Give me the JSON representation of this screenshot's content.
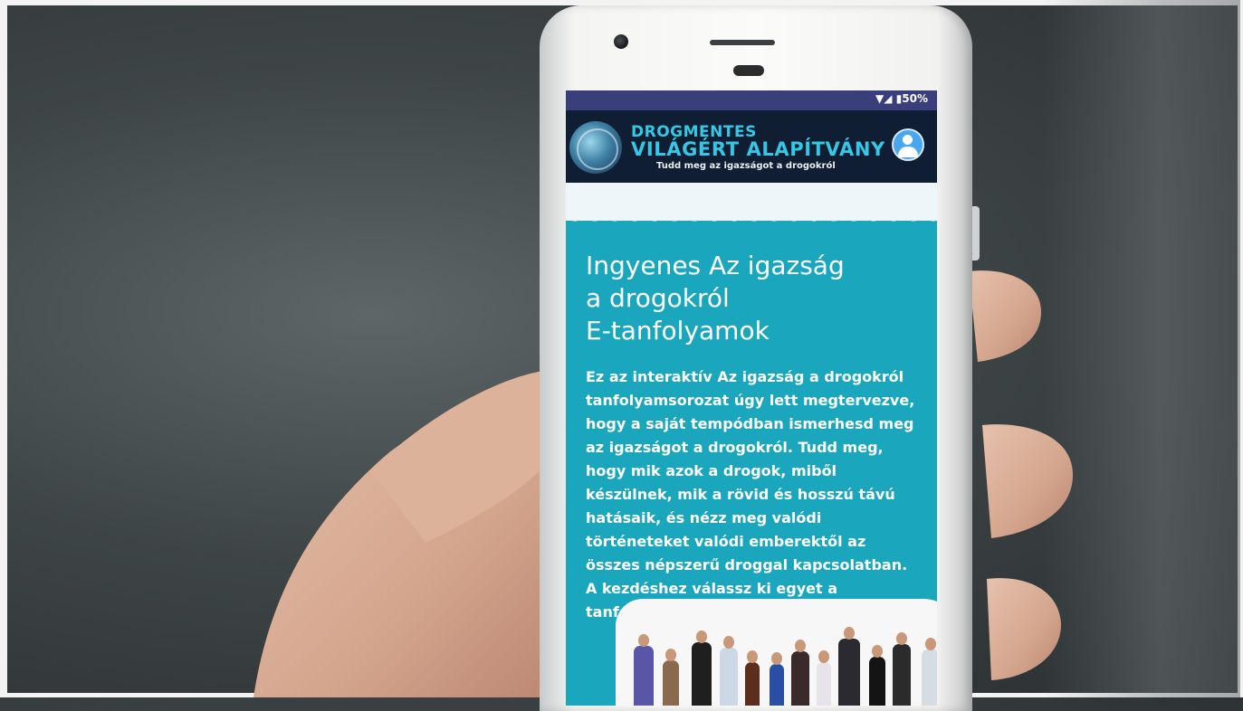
{
  "status_bar": {
    "indicators": "▼◢ ▮50%"
  },
  "header": {
    "brand_line1": "DROGMENTES",
    "brand_line2": "VILÁGÉRT ALAPÍTVÁNY",
    "tagline": "Tudd meg az igazságot a drogokról",
    "logo_icon": "globe-logo-icon",
    "profile_icon": "user-profile-icon"
  },
  "main": {
    "title_lines": [
      "Ingyenes Az igazság",
      "a drogokról",
      "E-tanfolyamok"
    ],
    "body": "Ez az interaktív Az igazság a drogokról tanfolyamsorozat úgy lett megtervezve, hogy a saját tempódban ismerhesd meg az igazságot a drogokról. Tudd meg, hogy mik azok a drogok, miből készülnek, mik a rövid és hosszú távú hatásaik, és nézz meg valódi történeteket valódi emberektől az összes népszerű droggal kapcsolatban. A kezdéshez válassz ki egyet a tanfolyamok közül az alábbi listából."
  },
  "colors": {
    "header_bg": "#0f1e33",
    "content_bg": "#1aa6bc",
    "brand_text": "#35c8e6",
    "status_bar": "#3a3f7c"
  }
}
